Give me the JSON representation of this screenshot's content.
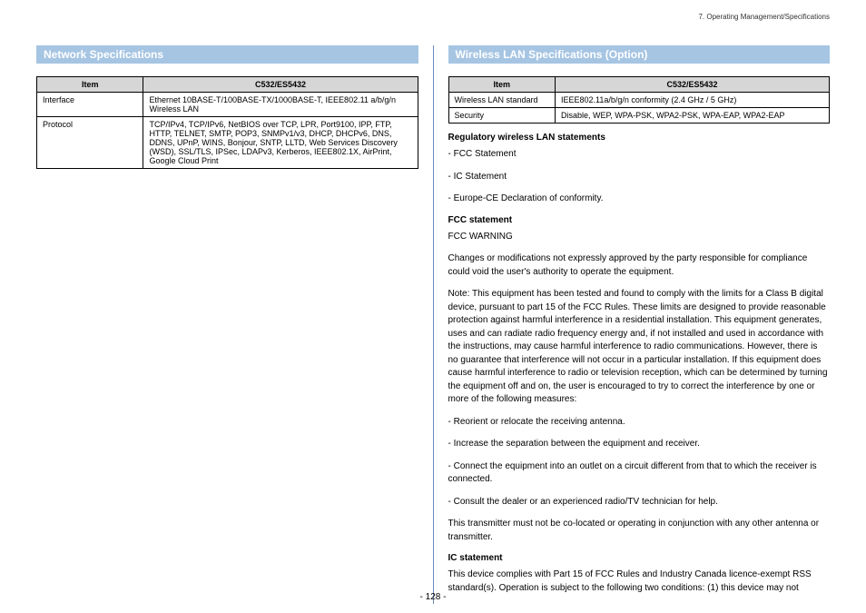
{
  "breadcrumb": "7. Operating Management/Specifications",
  "page_number": "- 128 -",
  "left": {
    "title": "Network Specifications",
    "table": {
      "headers": [
        "Item",
        "C532/ES5432"
      ],
      "rows": [
        [
          "Interface",
          "Ethernet 10BASE-T/100BASE-TX/1000BASE-T, IEEE802.11 a/b/g/n Wireless LAN"
        ],
        [
          "Protocol",
          "TCP/IPv4, TCP/IPv6, NetBIOS over TCP, LPR, Port9100, IPP, FTP, HTTP, TELNET, SMTP, POP3, SNMPv1/v3, DHCP, DHCPv6, DNS, DDNS, UPnP, WINS, Bonjour, SNTP, LLTD, Web Services Discovery (WSD), SSL/TLS, IPSec, LDAPv3, Kerberos, IEEE802.1X, AirPrint, Google Cloud Print"
        ]
      ]
    }
  },
  "right": {
    "title": "Wireless LAN Specifications (Option)",
    "table": {
      "headers": [
        "Item",
        "C532/ES5432"
      ],
      "rows": [
        [
          "Wireless LAN standard",
          "IEEE802.11a/b/g/n conformity (2.4 GHz / 5 GHz)"
        ],
        [
          "Security",
          "Disable, WEP, WPA-PSK, WPA2-PSK, WPA-EAP, WPA2-EAP"
        ]
      ]
    },
    "sub1": "Regulatory wireless LAN statements",
    "list1a": "- FCC Statement",
    "list1b": "- IC Statement",
    "list1c": "- Europe-CE Declaration of conformity.",
    "sub2": "FCC statement",
    "p1": "FCC WARNING",
    "p2": "Changes or modifications not expressly approved by the party responsible for compliance could void the user's authority to operate the equipment.",
    "p3": "Note: This equipment has been tested and found to comply with the limits for a Class B digital device, pursuant to part 15 of the FCC Rules. These limits are designed to provide reasonable protection against harmful interference in a residential installation. This equipment generates, uses and can radiate radio frequency energy and, if not installed and used in accordance with the instructions, may cause harmful interference to radio communications. However, there is no guarantee that interference will not occur in a particular installation. If this equipment does cause harmful interference to radio or television reception, which can be determined by turning the equipment off and on, the user is encouraged to try to correct the interference by one or more of the following measures:",
    "p4": "- Reorient or relocate the receiving antenna.",
    "p5": "- Increase the separation between the equipment and receiver.",
    "p6": "- Connect the equipment into an outlet on a circuit different from that to which the receiver is connected.",
    "p7": "- Consult the dealer or an experienced radio/TV technician for help.",
    "p8": "This transmitter must not be co-located or operating in conjunction with any other antenna or transmitter.",
    "sub3": "IC statement",
    "p9": "This device complies with Part 15 of FCC Rules and Industry Canada licence-exempt RSS standard(s). Operation is subject to the following two conditions: (1) this device may not"
  }
}
